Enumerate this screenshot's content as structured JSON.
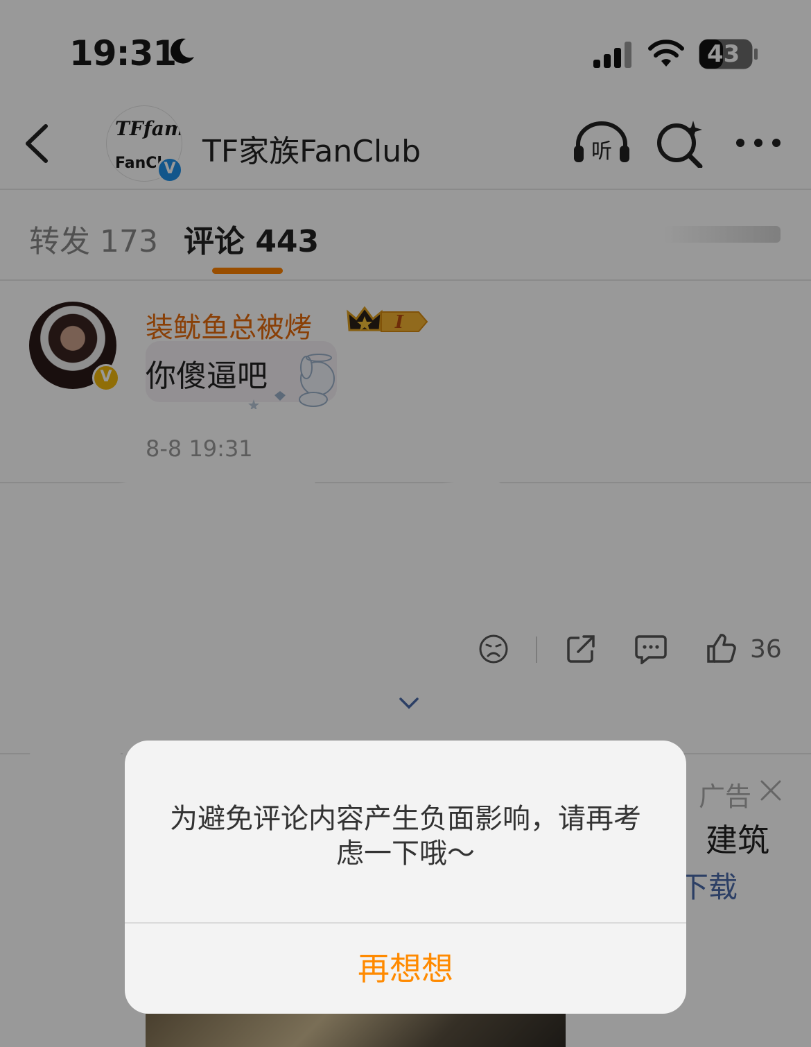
{
  "status_bar": {
    "time": "19:31",
    "battery": "43"
  },
  "header": {
    "title": "TF家族FanClub",
    "avatar_logo_script": "TFfamily",
    "avatar_logo_text": "FanCl",
    "verify_mark": "V"
  },
  "tabs": [
    {
      "label": "转发 173"
    },
    {
      "label": "评论 443"
    }
  ],
  "comment": {
    "username": "装鱿鱼总被烤_",
    "badge_text": "I",
    "avatar_badge": "V",
    "text": "你傻逼吧",
    "time": "8-8 19:31"
  },
  "actions": {
    "like_count": "36"
  },
  "ad": {
    "label": "广告",
    "title": "建筑",
    "download": "下载"
  },
  "dialog": {
    "message": "为避免评论内容产生负面影响，请再考虑一下哦～",
    "button": "再想想"
  },
  "colors": {
    "accent": "#ff8200",
    "username": "#e46a0b",
    "verified": "#1f8fe8",
    "dialog_button": "#ff8a00"
  },
  "icons": [
    "back-icon",
    "listen-icon",
    "search-icon",
    "more-icon",
    "dislike-icon",
    "share-icon",
    "comment-icon",
    "like-icon",
    "close-icon",
    "chevron-down-icon",
    "moon-icon",
    "signal-icon",
    "wifi-icon",
    "battery-icon"
  ]
}
